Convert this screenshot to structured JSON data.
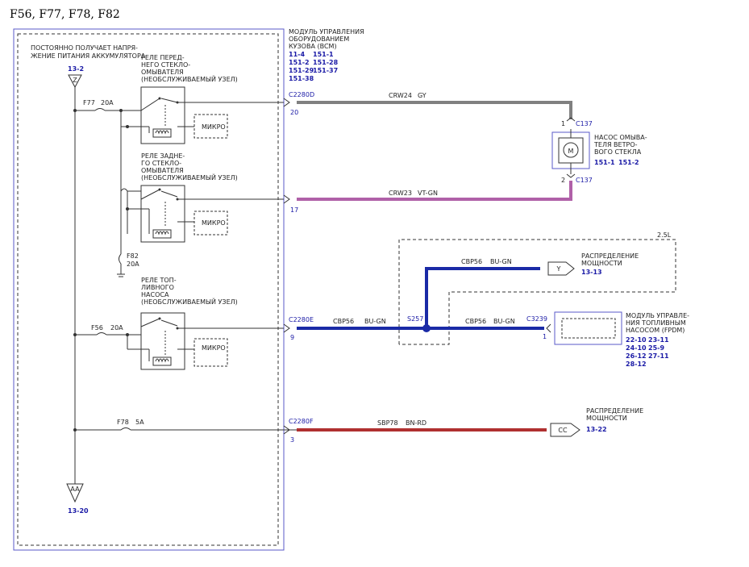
{
  "page_title": "F56, F77, F78, F82",
  "colors": {
    "gray_wire": "#808080",
    "violet_wire": "#b060a8",
    "blue_wire": "#1a2aa6",
    "red_wire": "#b03030",
    "module_border": "#5a5ac8",
    "ref_text": "#1a1aa6"
  },
  "fuse_box": {
    "battery_note_1": "ПОСТОЯННО ПОЛУЧАЕТ НАПРЯ-",
    "battery_note_2": "ЖЕНИЕ ПИТАНИЯ АККУМУЛЯТОРА",
    "z_terminal": {
      "ref": "13-2",
      "symbol": "Z"
    },
    "aa_terminal": {
      "symbol": "AA",
      "ref": "13-20"
    },
    "fuses": [
      {
        "name": "F77",
        "rating": "20A"
      },
      {
        "name": "F82",
        "rating": "20A"
      },
      {
        "name": "F56",
        "rating": "20A"
      },
      {
        "name": "F78",
        "rating": "5A"
      }
    ],
    "relays": [
      {
        "title_lines": [
          "РЕЛЕ ПЕРЕД-",
          "НЕГО СТЕКЛО-",
          "ОМЫВАТЕЛЯ",
          "(НЕОБСЛУЖИВАЕМЫЙ УЗЕЛ)"
        ],
        "micro": "МИКРО"
      },
      {
        "title_lines": [
          "РЕЛЕ ЗАДНЕ-",
          "ГО СТЕКЛО-",
          "ОМЫВАТЕЛЯ",
          "(НЕОБСЛУЖИВАЕМЫЙ УЗЕЛ)"
        ],
        "micro": "МИКРО"
      },
      {
        "title_lines": [
          "РЕЛЕ ТОП-",
          "ЛИВНОГО",
          "НАСОСА",
          "(НЕОБСЛУЖИВАЕМЫЙ УЗЕЛ)"
        ],
        "micro": "МИКРО"
      }
    ]
  },
  "bcm": {
    "title_lines": [
      "МОДУЛЬ УПРАВЛЕНИЯ",
      "ОБОРУДОВАНИЕМ",
      "КУЗОВА (BCM)"
    ],
    "refs": [
      [
        "11-4",
        "151-1"
      ],
      [
        "151-2",
        "151-28"
      ],
      [
        "151-29",
        "151-37"
      ],
      [
        "151-38"
      ]
    ]
  },
  "circuits": [
    {
      "connector": "C2280D",
      "pin": "20",
      "wire": "CRW24",
      "color_code": "GY"
    },
    {
      "connector": "",
      "pin": "17",
      "wire": "CRW23",
      "color_code": "VT-GN"
    },
    {
      "connector": "C2280E",
      "pin": "9",
      "wire": "CBP56",
      "color_code": "BU-GN"
    },
    {
      "connector": "C2280F",
      "pin": "3",
      "wire": "SBP78",
      "color_code": "BN-RD"
    }
  ],
  "washer_pump": {
    "title_lines": [
      "НАСОС ОМЫВА-",
      "ТЕЛЯ ВЕТРО-",
      "ВОГО СТЕКЛА"
    ],
    "refs": [
      "151-1",
      "151-2"
    ],
    "motor_symbol": "M",
    "pin_top": "1",
    "pin_bottom": "2",
    "connector": "C137"
  },
  "engine_group": {
    "label": "2.5L",
    "splice": "S257",
    "upper_wire": {
      "wire": "CBP56",
      "color_code": "BU-GN"
    },
    "lower_wire": {
      "wire": "CBP56",
      "color_code": "BU-GN"
    },
    "connector": "C3239",
    "pin": "1"
  },
  "power_dist_y": {
    "symbol": "Y",
    "title_lines": [
      "РАСПРЕДЕЛЕНИЕ",
      "МОЩНОСТИ"
    ],
    "ref": "13-13"
  },
  "power_dist_cc": {
    "symbol": "CC",
    "title_lines": [
      "РАСПРЕДЕЛЕНИЕ",
      "МОЩНОСТИ"
    ],
    "ref": "13-22"
  },
  "fpdm": {
    "title_lines": [
      "МОДУЛЬ УПРАВЛЕ-",
      "НИЯ ТОПЛИВНЫМ",
      "НАСОСОМ (FPDM)"
    ],
    "refs": [
      [
        "22-10",
        "23-11"
      ],
      [
        "24-10",
        "25-9"
      ],
      [
        "26-12",
        "27-11"
      ],
      [
        "28-12"
      ]
    ]
  }
}
